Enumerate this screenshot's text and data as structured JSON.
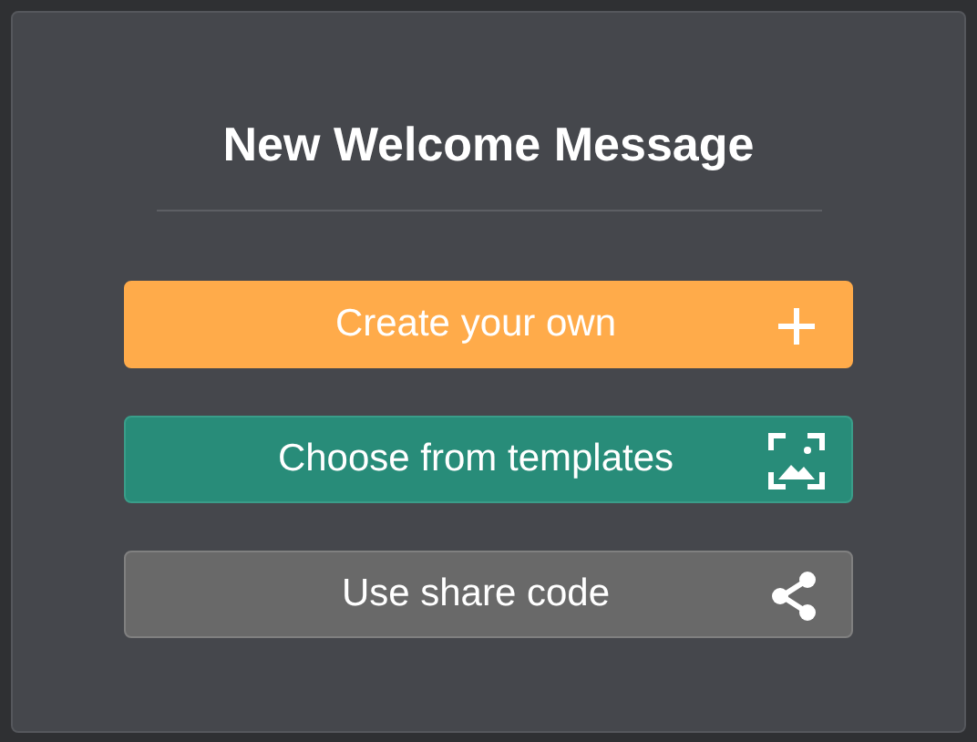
{
  "title": "New Welcome Message",
  "options": [
    {
      "label": "Create your own",
      "kind": "create"
    },
    {
      "label": "Choose from templates",
      "kind": "templates"
    },
    {
      "label": "Use share code",
      "kind": "share"
    }
  ]
}
